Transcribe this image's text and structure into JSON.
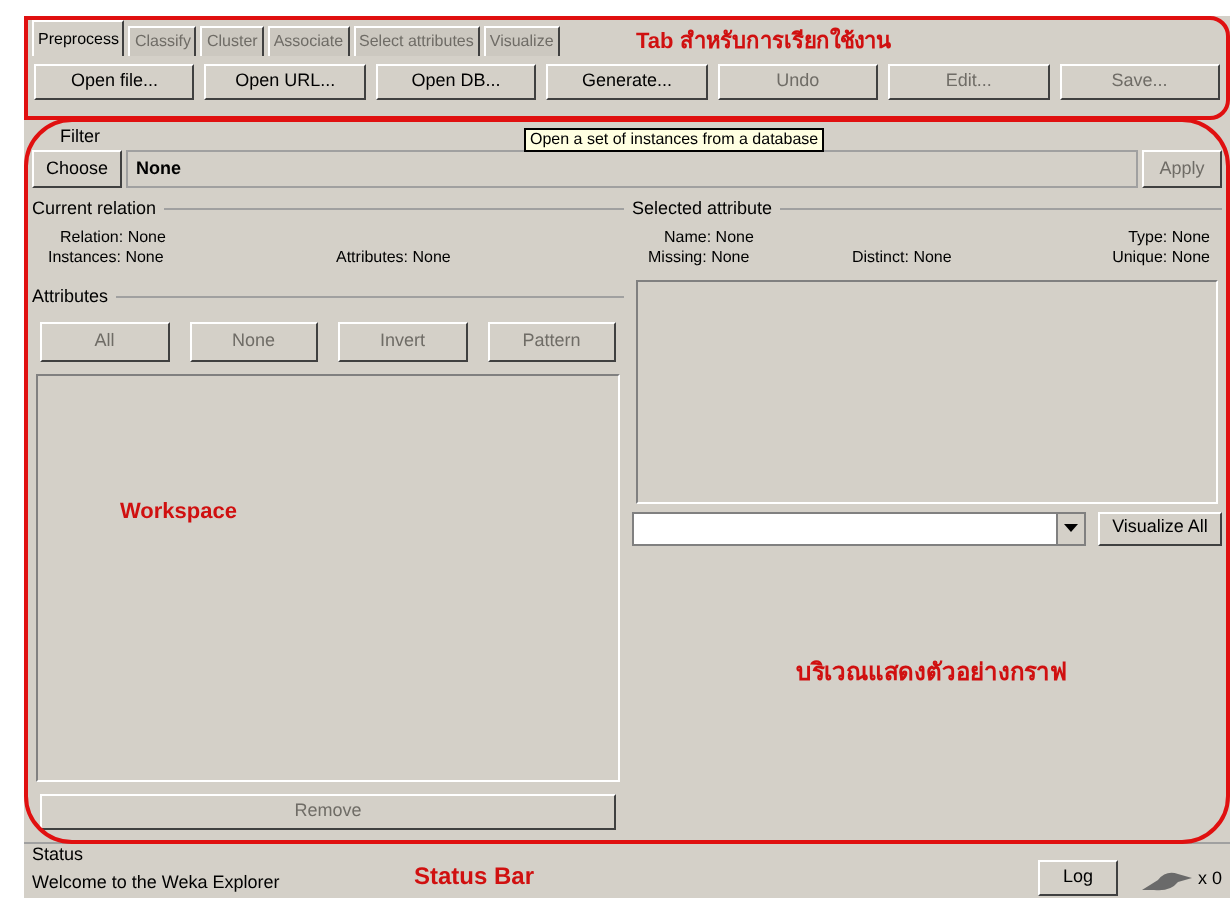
{
  "tabs": [
    {
      "label": "Preprocess",
      "selected": true,
      "disabled": false
    },
    {
      "label": "Classify",
      "selected": false,
      "disabled": true
    },
    {
      "label": "Cluster",
      "selected": false,
      "disabled": true
    },
    {
      "label": "Associate",
      "selected": false,
      "disabled": true
    },
    {
      "label": "Select attributes",
      "selected": false,
      "disabled": true
    },
    {
      "label": "Visualize",
      "selected": false,
      "disabled": true
    }
  ],
  "toolbar_buttons": [
    {
      "label": "Open file...",
      "disabled": false
    },
    {
      "label": "Open URL...",
      "disabled": false
    },
    {
      "label": "Open DB...",
      "disabled": false
    },
    {
      "label": "Generate...",
      "disabled": false
    },
    {
      "label": "Undo",
      "disabled": true
    },
    {
      "label": "Edit...",
      "disabled": true
    },
    {
      "label": "Save...",
      "disabled": true
    }
  ],
  "annotations": {
    "tabs": "Tab สำหรับการเรียกใช้งาน",
    "workspace": "Workspace",
    "graph_area": "บริเวณแสดงตัวอย่างกราฟ",
    "status_bar": "Status Bar"
  },
  "tooltip": "Open a set of instances from a database",
  "filter": {
    "title": "Filter",
    "choose_button": "Choose",
    "value": "None",
    "apply_button": {
      "label": "Apply",
      "disabled": true
    }
  },
  "current_relation": {
    "title": "Current relation",
    "fields": [
      {
        "label": "Relation:",
        "value": "None"
      },
      {
        "label": "Instances:",
        "value": "None"
      },
      {
        "label": "Attributes:",
        "value": "None"
      }
    ]
  },
  "attributes": {
    "title": "Attributes",
    "buttons": [
      {
        "label": "All",
        "disabled": true
      },
      {
        "label": "None",
        "disabled": true
      },
      {
        "label": "Invert",
        "disabled": true
      },
      {
        "label": "Pattern",
        "disabled": true
      }
    ],
    "remove_button": {
      "label": "Remove",
      "disabled": true
    }
  },
  "selected_attribute": {
    "title": "Selected attribute",
    "fields": [
      {
        "label": "Name:",
        "value": "None"
      },
      {
        "label": "Type:",
        "value": "None"
      },
      {
        "label": "Missing:",
        "value": "None"
      },
      {
        "label": "Distinct:",
        "value": "None"
      },
      {
        "label": "Unique:",
        "value": "None"
      }
    ]
  },
  "visualize_all_button": "Visualize All",
  "status": {
    "title": "Status",
    "message": "Welcome to the Weka Explorer",
    "log_button": "Log",
    "count": "x 0"
  }
}
